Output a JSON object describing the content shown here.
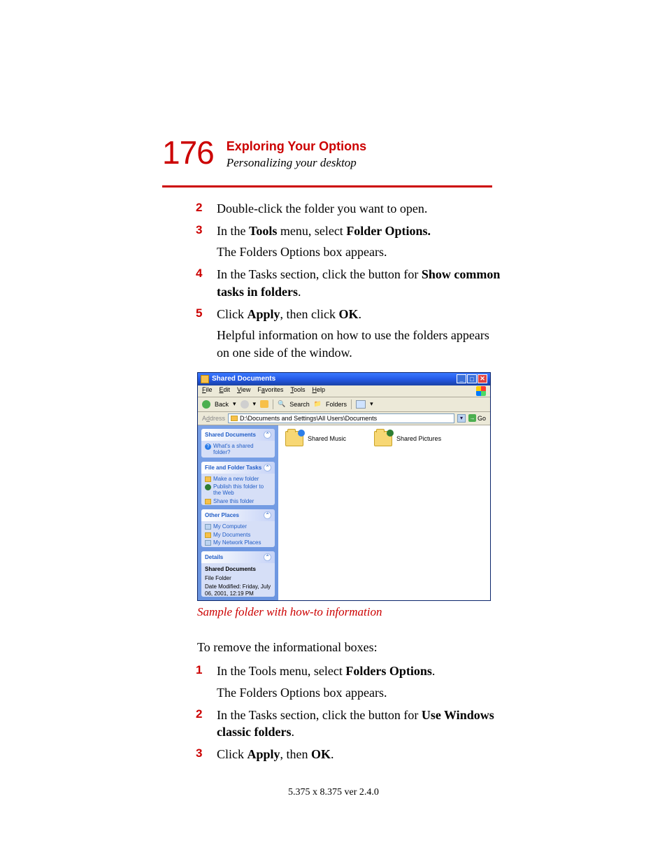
{
  "page_number": "176",
  "chapter_title": "Exploring Your Options",
  "section_subtitle": "Personalizing your desktop",
  "steps_a": [
    {
      "num": "2",
      "text": "Double-click the folder you want to open."
    },
    {
      "num": "3",
      "text_pre": "In the ",
      "b1": "Tools",
      "text_mid": " menu, select ",
      "b2": "Folder Options.",
      "sub": "The Folders Options box appears."
    },
    {
      "num": "4",
      "text_pre": "In the Tasks section, click the button for ",
      "b1": "Show common tasks in folders",
      "text_post": "."
    },
    {
      "num": "5",
      "text_pre": " Click ",
      "b1": "Apply",
      "text_mid": ", then click ",
      "b2": "OK",
      "text_post": ".",
      "sub": "Helpful information on how to use the folders appears on one side of the window."
    }
  ],
  "xp": {
    "title": "Shared Documents",
    "menus": {
      "file": "File",
      "edit": "Edit",
      "view": "View",
      "favorites": "Favorites",
      "tools": "Tools",
      "help": "Help"
    },
    "toolbar": {
      "back": "Back",
      "search": "Search",
      "folders": "Folders"
    },
    "address_label": "Address",
    "address_path": "D:\\Documents and Settings\\All Users\\Documents",
    "go": "Go",
    "panel1": {
      "head": "Shared Documents",
      "link1": "What's a shared folder?"
    },
    "panel2": {
      "head": "File and Folder Tasks",
      "l1": "Make a new folder",
      "l2": "Publish this folder to the Web",
      "l3": "Share this folder"
    },
    "panel3": {
      "head": "Other Places",
      "l1": "My Computer",
      "l2": "My Documents",
      "l3": "My Network Places"
    },
    "panel4": {
      "head": "Details",
      "name": "Shared Documents",
      "type": "File Folder",
      "mod": "Date Modified: Friday, July 06, 2001, 12:19 PM"
    },
    "item1": "Shared Music",
    "item2": "Shared Pictures"
  },
  "caption": "Sample folder with how-to information",
  "remove_intro": "To remove the informational boxes:",
  "steps_b": [
    {
      "num": "1",
      "text_pre": "In the Tools menu, select ",
      "b1": "Folders Options",
      "text_post": ".",
      "sub": "The Folders Options box appears."
    },
    {
      "num": "2",
      "text_pre": "In the Tasks section, click the button for ",
      "b1": "Use Windows classic folders",
      "text_post": "."
    },
    {
      "num": "3",
      "text_pre": "Click ",
      "b1": "Apply",
      "text_mid": ", then ",
      "b2": "OK",
      "text_post": "."
    }
  ],
  "footer": "5.375 x 8.375 ver 2.4.0"
}
